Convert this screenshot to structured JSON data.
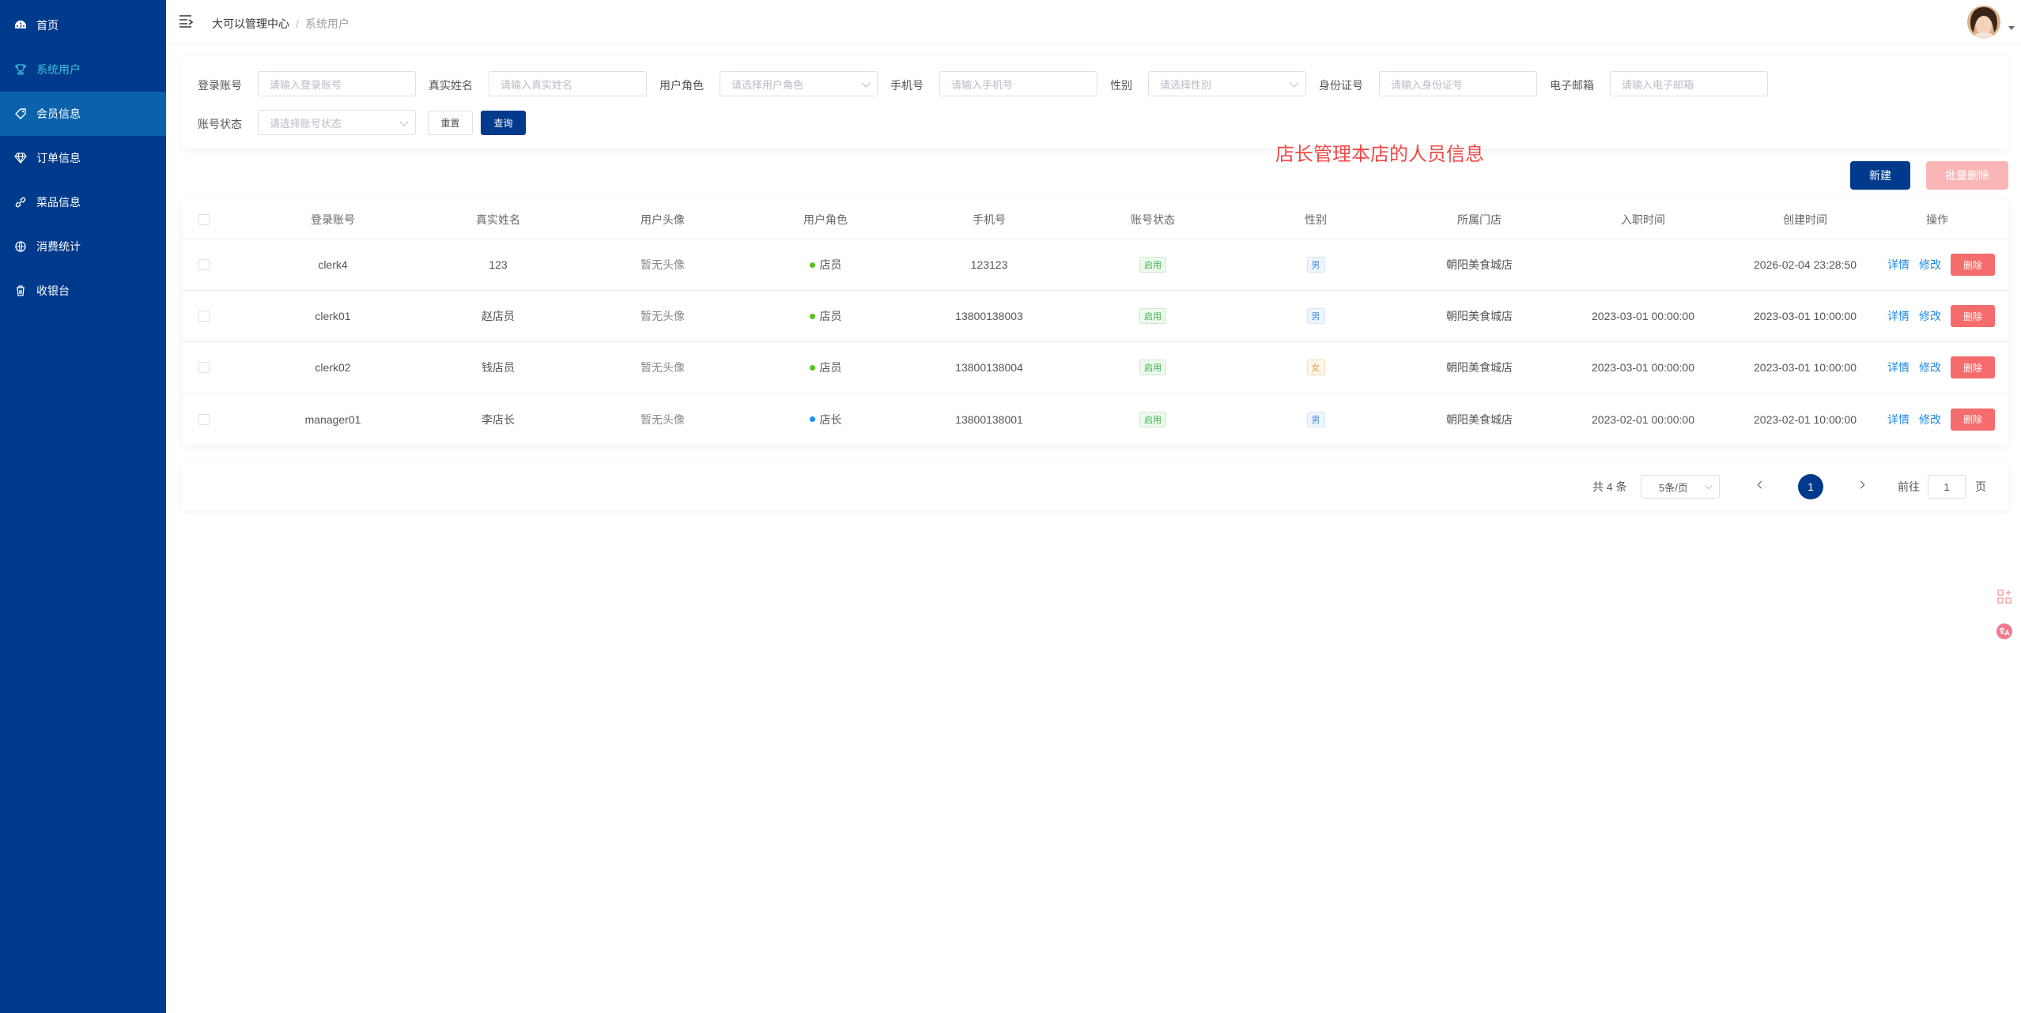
{
  "sidebar": {
    "items": [
      {
        "label": "首页",
        "icon": "dashboard-icon"
      },
      {
        "label": "系统用户",
        "icon": "trophy-icon"
      },
      {
        "label": "会员信息",
        "icon": "tag-icon"
      },
      {
        "label": "订单信息",
        "icon": "diamond-icon"
      },
      {
        "label": "菜品信息",
        "icon": "link-icon"
      },
      {
        "label": "消费统计",
        "icon": "basketball-icon"
      },
      {
        "label": "收银台",
        "icon": "trash-icon"
      }
    ]
  },
  "header": {
    "breadcrumb_root": "大可以管理中心",
    "breadcrumb_sep": "/",
    "breadcrumb_current": "系统用户"
  },
  "filter": {
    "login_label": "登录账号",
    "login_placeholder": "请输入登录账号",
    "realname_label": "真实姓名",
    "realname_placeholder": "请输入真实姓名",
    "role_label": "用户角色",
    "role_placeholder": "请选择用户角色",
    "phone_label": "手机号",
    "phone_placeholder": "请输入手机号",
    "gender_label": "性别",
    "gender_placeholder": "请选择性别",
    "idcard_label": "身份证号",
    "idcard_placeholder": "请输入身份证号",
    "email_label": "电子邮箱",
    "email_placeholder": "请输入电子邮箱",
    "status_label": "账号状态",
    "status_placeholder": "请选择账号状态",
    "reset_label": "重置",
    "query_label": "查询"
  },
  "notice": "店长管理本店的人员信息",
  "actions": {
    "new_label": "新建",
    "batch_delete_label": "批量删除"
  },
  "table": {
    "headers": [
      "登录账号",
      "真实姓名",
      "用户头像",
      "用户角色",
      "手机号",
      "账号状态",
      "性别",
      "所属门店",
      "入职时间",
      "创建时间",
      "操作"
    ],
    "rows": [
      {
        "login": "clerk4",
        "name": "123",
        "avatar": "暂无头像",
        "role": "店员",
        "role_color": "#52c41a",
        "phone": "123123",
        "status": "启用",
        "gender": "男",
        "gender_style": "blue",
        "store": "朝阳美食城店",
        "hired": "",
        "created": "2026-02-04 23:28:50"
      },
      {
        "login": "clerk01",
        "name": "赵店员",
        "avatar": "暂无头像",
        "role": "店员",
        "role_color": "#52c41a",
        "phone": "13800138003",
        "status": "启用",
        "gender": "男",
        "gender_style": "blue",
        "store": "朝阳美食城店",
        "hired": "2023-03-01 00:00:00",
        "created": "2023-03-01 10:00:00"
      },
      {
        "login": "clerk02",
        "name": "钱店员",
        "avatar": "暂无头像",
        "role": "店员",
        "role_color": "#52c41a",
        "phone": "13800138004",
        "status": "启用",
        "gender": "女",
        "gender_style": "orange",
        "store": "朝阳美食城店",
        "hired": "2023-03-01 00:00:00",
        "created": "2023-03-01 10:00:00"
      },
      {
        "login": "manager01",
        "name": "李店长",
        "avatar": "暂无头像",
        "role": "店长",
        "role_color": "#1890ff",
        "phone": "13800138001",
        "status": "启用",
        "gender": "男",
        "gender_style": "blue",
        "store": "朝阳美食城店",
        "hired": "2023-02-01 00:00:00",
        "created": "2023-02-01 10:00:00"
      }
    ],
    "op_detail": "详情",
    "op_edit": "修改",
    "op_delete": "删除"
  },
  "pagination": {
    "total": "共 4 条",
    "page_size": "5条/页",
    "current": "1",
    "goto_label": "前往",
    "goto_value": "1",
    "page_suffix": "页"
  },
  "colors": {
    "sidebar": "#003a8c",
    "active_item": "#0a62ad",
    "active_text": "#36c3d6",
    "primary": "#003a8c",
    "danger": "#f56c6c",
    "notice": "#f04848"
  }
}
